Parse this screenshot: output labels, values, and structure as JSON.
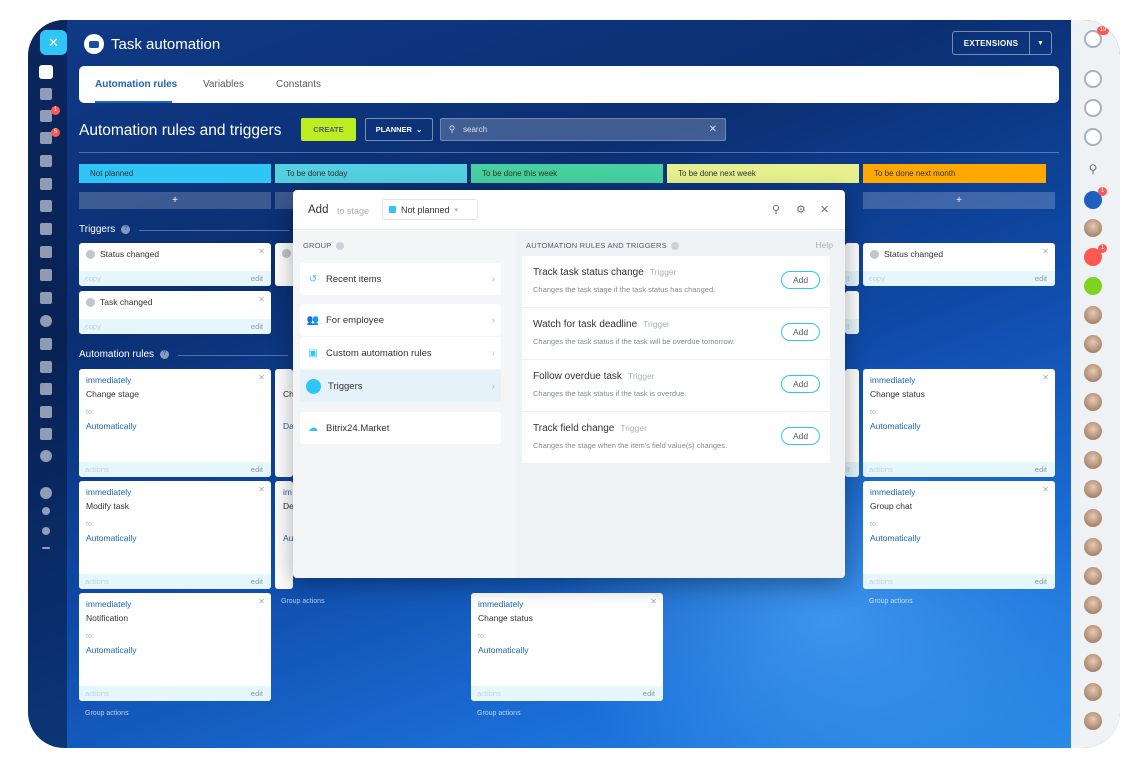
{
  "app": {
    "title": "Task automation",
    "extensions_label": "EXTENSIONS"
  },
  "left_nav": {
    "badges": [
      "1",
      "5"
    ]
  },
  "right_nav": {
    "top_badge": "19",
    "badges": [
      "1",
      "1"
    ]
  },
  "tabs": [
    "Automation rules",
    "Variables",
    "Constants"
  ],
  "toolbar": {
    "heading": "Automation rules and triggers",
    "create_label": "CREATE",
    "planner_label": "PLANNER",
    "search_placeholder": "search"
  },
  "stages": [
    {
      "label": "Not planned",
      "color": "#2fc6f6"
    },
    {
      "label": "To be done today",
      "color": "#55d0e0"
    },
    {
      "label": "To be done this week",
      "color": "#47d1a0"
    },
    {
      "label": "To be done next week",
      "color": "#e6f08e"
    },
    {
      "label": "To be done next month",
      "color": "#ffa900"
    }
  ],
  "plus_label": "+",
  "sections": {
    "triggers": "Triggers",
    "rules": "Automation rules"
  },
  "trigger_cards": [
    {
      "title": "Status changed",
      "copy": "copy",
      "edit": "edit"
    },
    {
      "title": "Task changed",
      "copy": "copy",
      "edit": "edit"
    },
    {
      "title": "Status changed",
      "copy": "copy",
      "edit": "edit"
    }
  ],
  "rule_cards": [
    {
      "when": "immediately",
      "name": "Change stage",
      "to": "to:",
      "auto": "Automatically",
      "actions": "actions",
      "edit": "edit"
    },
    {
      "when": "immediately",
      "name": "Modify task",
      "to": "to:",
      "auto": "Automatically",
      "actions": "actions",
      "edit": "edit"
    },
    {
      "when": "immediately",
      "name": "Notification",
      "to": "to:",
      "auto": "Automatically",
      "actions": "actions",
      "edit": "edit"
    },
    {
      "when": "immediately",
      "name": "Change status",
      "to": "to:",
      "auto": "Automatically",
      "actions": "actions",
      "edit": "edit"
    },
    {
      "when": "immediately",
      "name": "Group chat",
      "to": "to:",
      "auto": "Automatically",
      "actions": "actions",
      "edit": "edit"
    },
    {
      "when": "immediately",
      "name": "Change status",
      "to": "to:",
      "auto": "Automatically",
      "actions": "actions",
      "edit": "edit"
    }
  ],
  "partial_texts": {
    "lt": "lt",
    "ch": "Ch",
    "da": "Da",
    "im": "im",
    "de": "De",
    "au": "Au"
  },
  "group_actions": "Group actions",
  "modal": {
    "add_label": "Add",
    "to_stage_label": "to stage",
    "stage_value": "Not planned",
    "group_header": "GROUP",
    "rules_header": "AUTOMATION RULES AND TRIGGERS",
    "help_label": "Help",
    "groups": [
      {
        "label": "Recent items",
        "icon": "clock-icon"
      },
      {
        "label": "For employee",
        "icon": "people-icon"
      },
      {
        "label": "Custom automation rules",
        "icon": "robot-icon"
      },
      {
        "label": "Triggers",
        "icon": "trigger-icon",
        "active": true
      },
      {
        "label": "Bitrix24.Market",
        "icon": "market-icon"
      }
    ],
    "triggers": [
      {
        "title": "Track task status change",
        "tag": "Trigger",
        "desc": "Changes the task stage if the task status has changed.",
        "button": "Add"
      },
      {
        "title": "Watch for task deadline",
        "tag": "Trigger",
        "desc": "Changes the task status if the task will be overdue tomorrow.",
        "button": "Add"
      },
      {
        "title": "Follow overdue task",
        "tag": "Trigger",
        "desc": "Changes the task status if the task is overdue.",
        "button": "Add"
      },
      {
        "title": "Track field change",
        "tag": "Trigger",
        "desc": "Changes the stage when the item's field value(s) changes.",
        "button": "Add"
      }
    ]
  }
}
